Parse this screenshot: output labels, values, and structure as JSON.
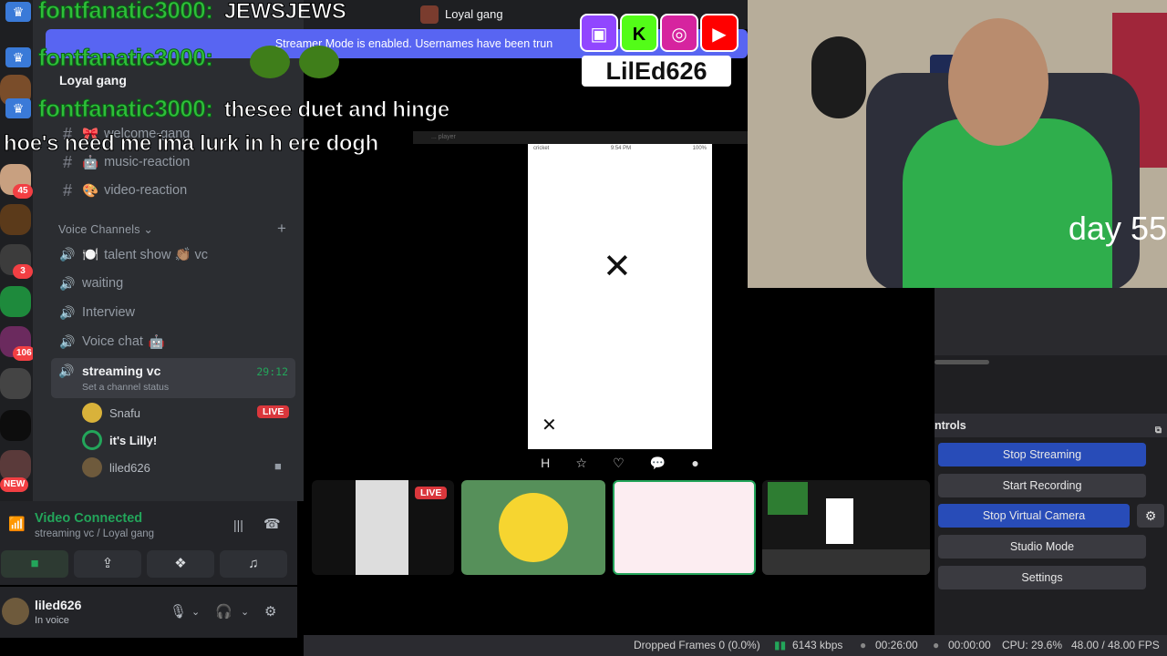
{
  "discord": {
    "server_name": "Loyal gang",
    "banner_text": "Streamer Mode is enabled. Usernames have been trun",
    "top_group_name": "Loyal gang",
    "channels": [
      {
        "name": "welcome-gang",
        "icon": "🎀"
      },
      {
        "name": "music-reaction",
        "icon": "🤖"
      },
      {
        "name": "video-reaction",
        "icon": "🎨"
      }
    ],
    "voice_section_label": "Voice Channels",
    "voice_channels": [
      {
        "name": "talent show 👏🏽 vc",
        "icon": "🍽️"
      },
      {
        "name": "waiting"
      },
      {
        "name": "Interview"
      },
      {
        "name": "Voice chat",
        "icon": "🤖"
      }
    ],
    "active_voice": {
      "name": "streaming vc",
      "status": "Set a channel status",
      "timer": "29:12",
      "members": [
        {
          "name": "Snafu",
          "live": "LIVE"
        },
        {
          "name": "it's Lilly!"
        },
        {
          "name": "liled626"
        }
      ]
    },
    "rail_badges": [
      "45",
      "3",
      "106",
      "NEW"
    ],
    "voice_panel": {
      "connected": "Video Connected",
      "subtitle": "streaming vc / Loyal gang"
    },
    "user": {
      "name": "liled626",
      "state": "In voice"
    },
    "thumb_live": "LIVE"
  },
  "chat": [
    {
      "user": "fontfanatic3000:",
      "message": "JEWSJEWS"
    },
    {
      "user": "fontfanatic3000:",
      "message": ""
    },
    {
      "user": "fontfanatic3000:",
      "message": "thesee duet and hinge"
    },
    {
      "user": "",
      "message": "hoe's need me ima lurk in h ere dogh"
    }
  ],
  "stream_overlay": {
    "brand": "LilEd626",
    "day_label": "day 55",
    "socials": [
      "twitch-icon",
      "kick-icon",
      "instagram-icon",
      "youtube-icon"
    ]
  },
  "phone": {
    "carrier": "cricket",
    "time": "9:54 PM",
    "battery": "100%",
    "player_label": "... player"
  },
  "obs": {
    "controls_label": "ntrols",
    "buttons": {
      "stop_streaming": "Stop Streaming",
      "start_recording": "Start Recording",
      "stop_virtual_camera": "Stop Virtual Camera",
      "studio_mode": "Studio Mode",
      "settings": "Settings"
    },
    "status": {
      "dropped_frames": "Dropped Frames 0 (0.0%)",
      "kbps": "6143 kbps",
      "stream_time": "00:26:00",
      "rec_time": "00:00:00",
      "cpu": "CPU: 29.6%",
      "fps": "48.00 / 48.00 FPS"
    }
  },
  "colors": {
    "discord_blurple": "#5865f2",
    "discord_green": "#23a55a",
    "live_red": "#da373c",
    "obs_blue": "#284cb8",
    "chat_green": "#2fbe3a"
  }
}
